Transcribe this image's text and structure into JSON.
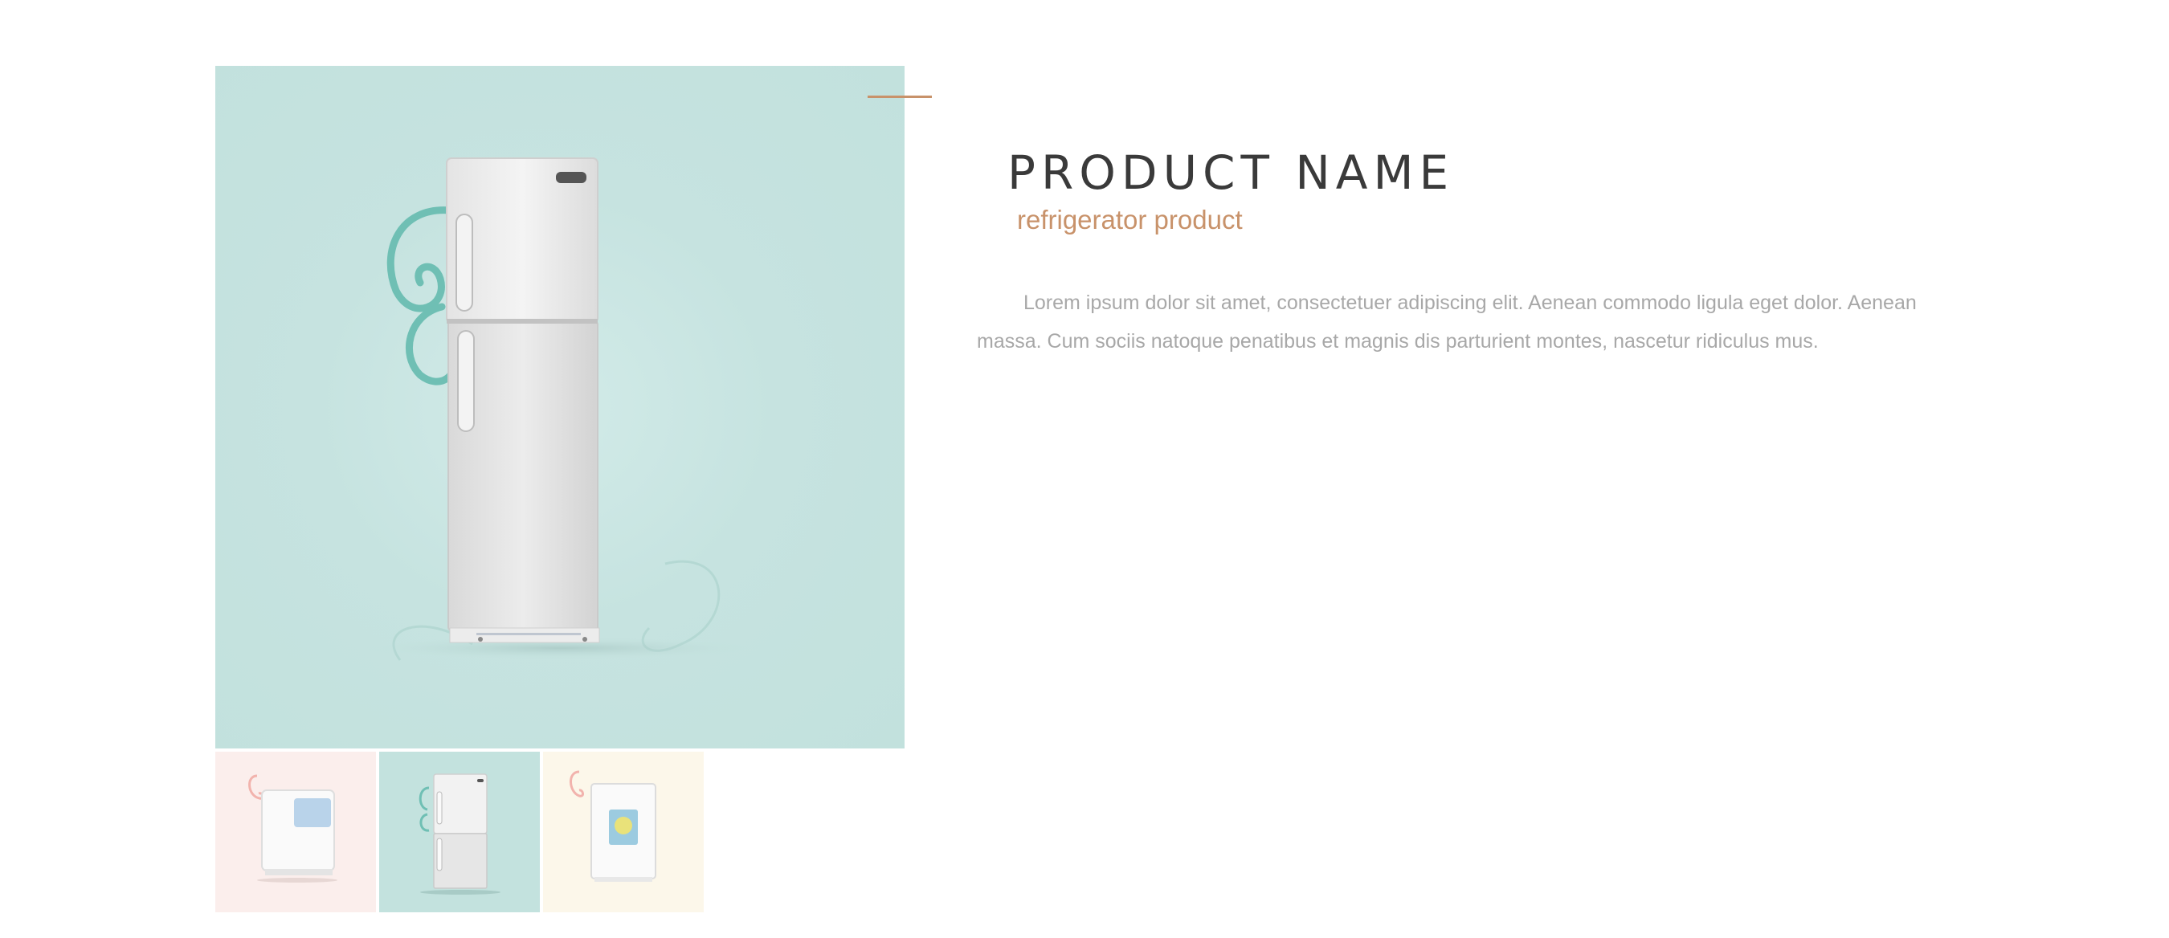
{
  "product": {
    "name": "PRODUCT NAME",
    "subtitle": "refrigerator product",
    "description": "Lorem ipsum dolor sit amet, consectetuer adipiscing elit. Aenean commodo ligula eget dolor. Aenean massa. Cum sociis natoque penatibus et magnis dis parturient montes, nascetur ridiculus mus."
  },
  "gallery": {
    "selected_index": 1,
    "thumbnails": [
      {
        "icon": "chest-freezer-image",
        "background": "#fbeeec"
      },
      {
        "icon": "refrigerator-image",
        "background": "#c3e2de"
      },
      {
        "icon": "mini-fridge-image",
        "background": "#fcf7ea"
      }
    ]
  },
  "colors": {
    "accent": "#c8926a",
    "title": "#3a3a3a",
    "body_text": "#a8a8a8",
    "main_image_bg": "#c6e3e0"
  }
}
